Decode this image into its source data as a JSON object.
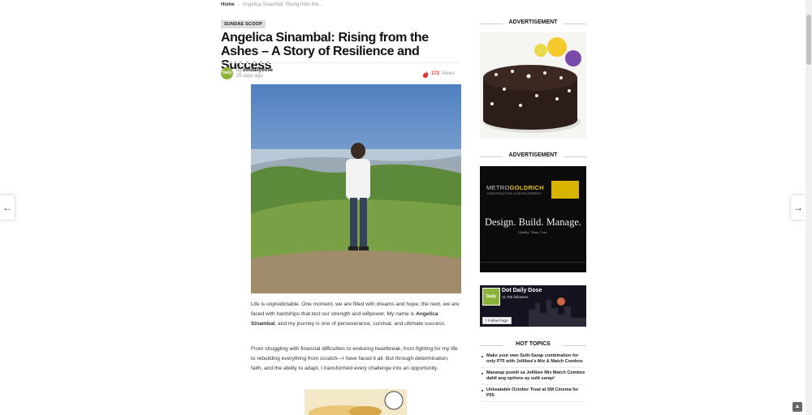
{
  "breadcrumb": {
    "home": "Home",
    "current": "Angelica Sinambal: Rising from the..."
  },
  "article": {
    "category": "SUNDAE SCOOP",
    "title": "Angelica Sinambal: Rising from the Ashes – A Story of Resilience and Success",
    "author_prefix": "by",
    "author": "dotdailydose",
    "posted": "25 days ago",
    "views_count": "172",
    "views_label": "Views",
    "p1_before": "Life is unpredictable. One moment, we are filled with dreams and hope; the next, we are faced with hardships that test our strength and willpower. My name is",
    "p1_name": "Angelica Sinambal",
    "p1_after": ", and my journey is one of perseverance, survival, and ultimate success.",
    "p2": "From struggling with financial difficulties to enduring heartbreak, from fighting for my life to rebuilding everything from scratch—I have faced it all. But through determination, faith, and the ability to adapt, I transformed every challenge into an opportunity."
  },
  "sidebar": {
    "ad_label_1": "ADVERTISEMENT",
    "ad_label_2": "ADVERTISEMENT",
    "metro_ad": {
      "brand_prefix": "METRO",
      "brand_main": "GOLDRICH",
      "sub": "CONSTRUCTION  &  DEVELOPMENT",
      "headline": "Design. Build. Manage.",
      "tagline": "Quality. Time. Cost."
    },
    "facebook": {
      "page_name": "Dot Daily Dose",
      "followers": "11,755 followers",
      "follow_label": "Follow Page",
      "logo_text": "Daily"
    },
    "hot_topics_title": "HOT TOPICS",
    "hot_topics": [
      "Make your own Sulit-Sarap combination for only P75 with Jollibee's Mix & Match Combos",
      "Masarap pumili sa Jollibee Mix Match Combos dahil ang options ay sulit sarap!",
      "Unbeatable October Treat at SM Cinema for P55"
    ]
  },
  "avatar_text": "Daily",
  "nav": {
    "prev_icon": "←",
    "next_icon": "→",
    "top_icon": "▲"
  },
  "colors": {
    "accent_red": "#e03131",
    "brand_green": "#8bb33a",
    "brand_gold": "#d8b400"
  }
}
